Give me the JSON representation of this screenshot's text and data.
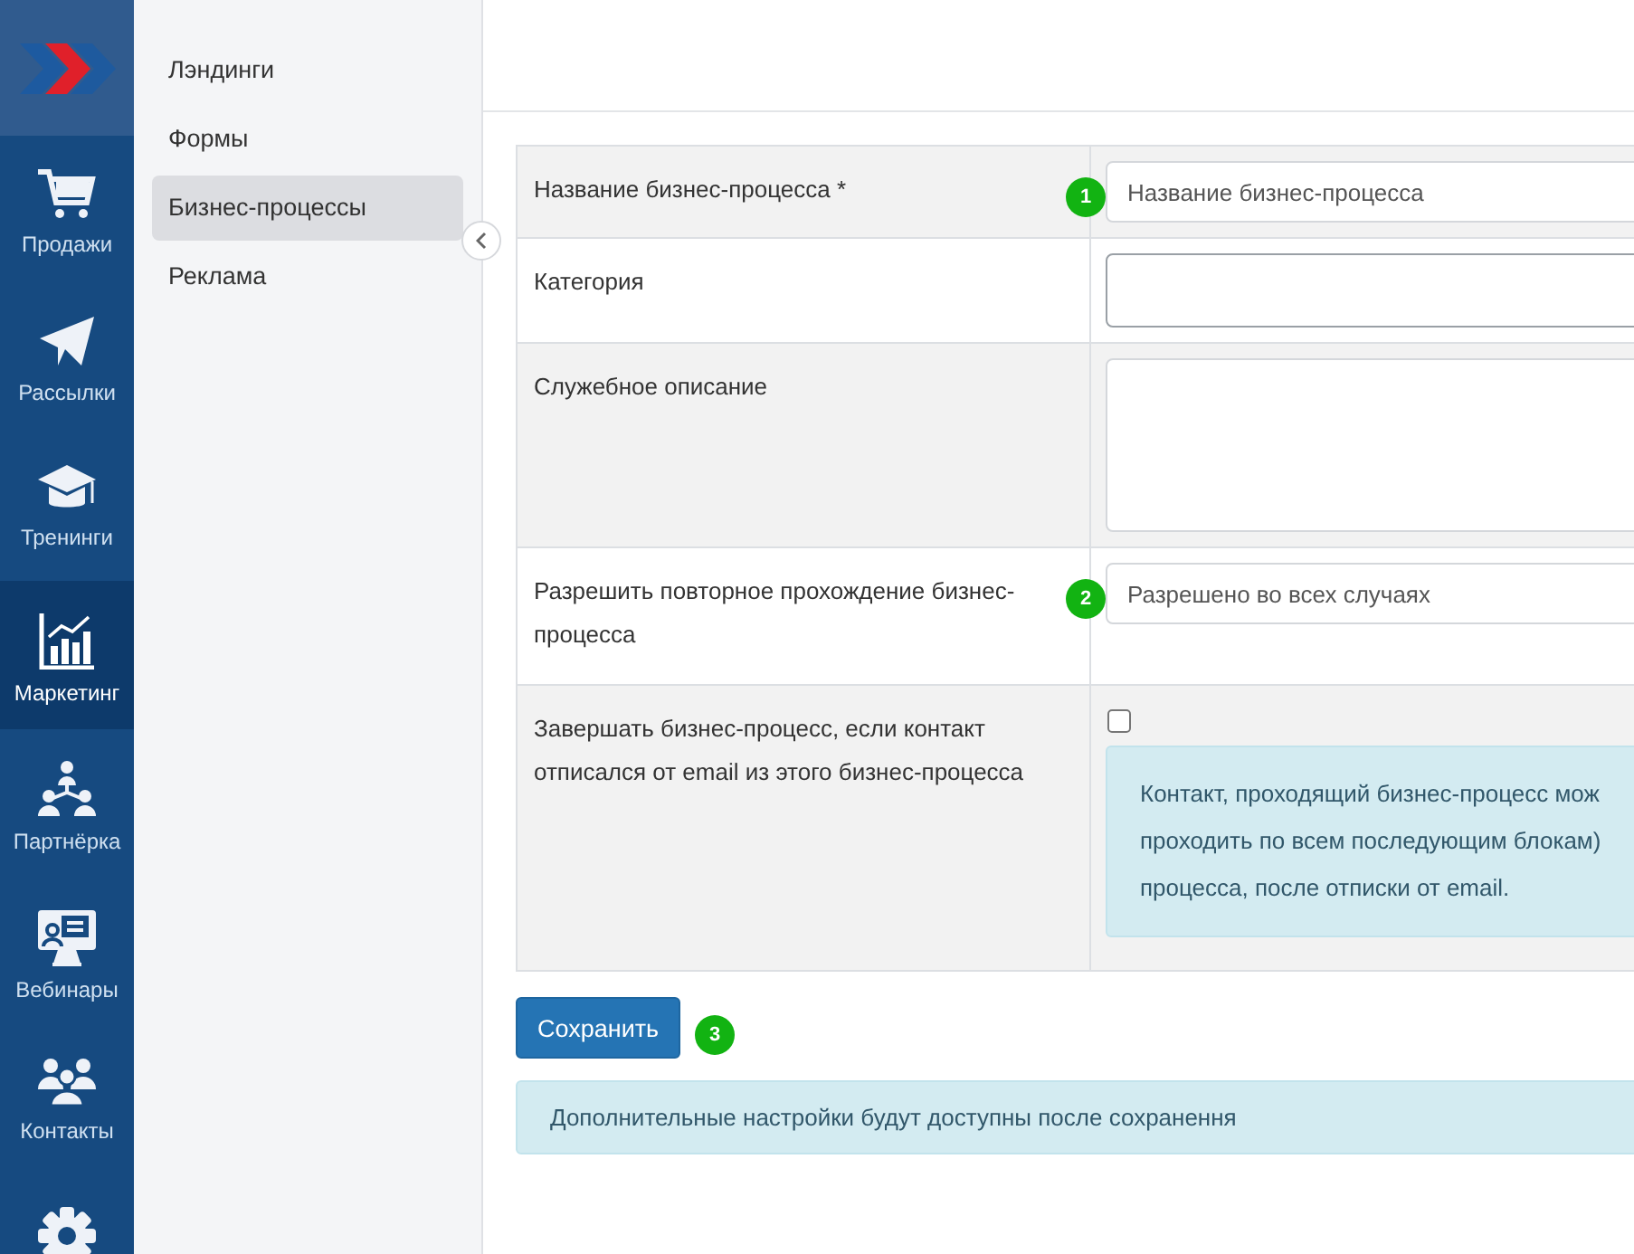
{
  "nav_rail": {
    "items": [
      {
        "kind": "cart",
        "label": "Продажи",
        "selected": false
      },
      {
        "kind": "plane",
        "label": "Рассылки",
        "selected": false
      },
      {
        "kind": "cap",
        "label": "Тренинги",
        "selected": false
      },
      {
        "kind": "chart",
        "label": "Маркетинг",
        "selected": true
      },
      {
        "kind": "tree",
        "label": "Партнёрка",
        "selected": false
      },
      {
        "kind": "monitor",
        "label": "Вебинары",
        "selected": false
      },
      {
        "kind": "people",
        "label": "Контакты",
        "selected": false
      },
      {
        "kind": "gear",
        "selected": false
      }
    ]
  },
  "subnav": {
    "items": [
      {
        "label": "Лэндинги",
        "selected": false
      },
      {
        "label": "Формы",
        "selected": false
      },
      {
        "label": "Бизнес-процессы",
        "selected": true
      },
      {
        "label": "Реклама",
        "selected": false
      }
    ]
  },
  "form": {
    "rows": [
      {
        "label": "Название бизнес-процесса *",
        "field": {
          "kind": "input",
          "value": "Название бизнес-процесса",
          "badge": "1"
        }
      },
      {
        "label": "Категория",
        "field": {
          "kind": "select"
        }
      },
      {
        "label": "Служебное описание",
        "field": {
          "kind": "textarea"
        }
      },
      {
        "label": "Разрешить повторное прохождение бизнес-процесса",
        "field": {
          "kind": "select",
          "value": "Разрешено во всех случаях",
          "badge": "2"
        }
      },
      {
        "label": "Завершать бизнес-процесс, если контакт отписался от email из этого бизнес-процесса",
        "field": {
          "kind": "checkbox",
          "checked": false,
          "note_lines": [
            "Контакт, проходящий бизнес-процесс мож",
            "проходить по всем последующим блокам)",
            "процесса, после отписки от email."
          ]
        }
      }
    ],
    "save_button": {
      "label": "Сохранить",
      "badge": "3"
    },
    "info": "Дополнительные настройки будут доступны после сохранення"
  }
}
